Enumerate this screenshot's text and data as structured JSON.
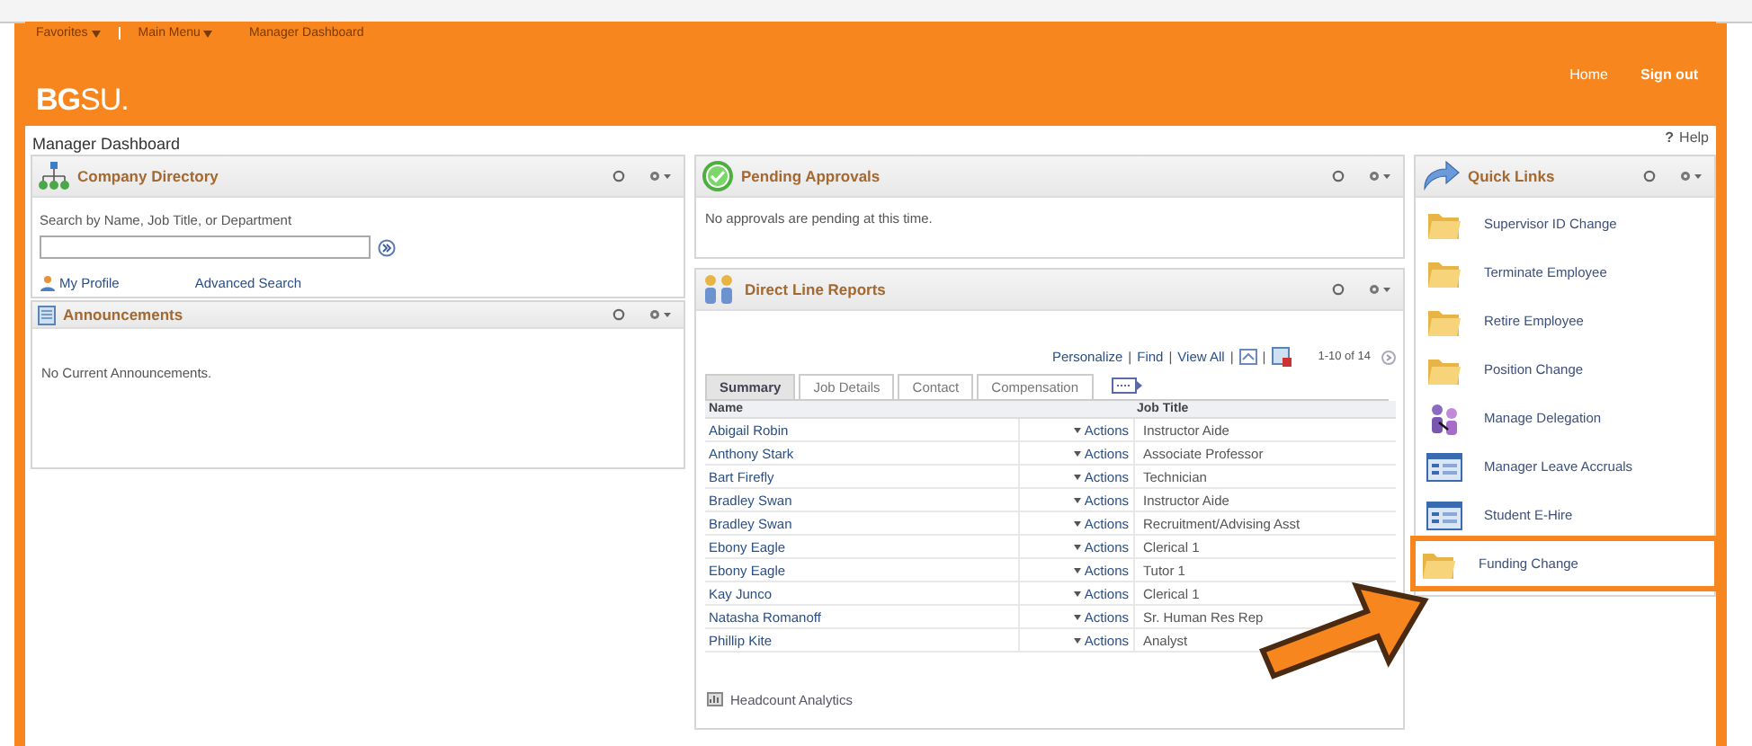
{
  "header": {
    "breadcrumbs": [
      {
        "label": "Favorites",
        "dropdown": true
      },
      {
        "label": "Main Menu",
        "dropdown": true
      },
      {
        "label": "Manager Dashboard",
        "dropdown": false
      }
    ],
    "logo": {
      "bold": "BG",
      "light": "SU."
    },
    "links": [
      "Home",
      "Sign out"
    ]
  },
  "page": {
    "title": "Manager Dashboard",
    "help": {
      "mark": "?",
      "label": "Help"
    }
  },
  "company_directory": {
    "title": "Company Directory",
    "search_label": "Search by Name, Job Title, or Department",
    "links": [
      "My Profile",
      "Advanced Search"
    ]
  },
  "announcements": {
    "title": "Announcements",
    "message": "No Current Announcements."
  },
  "pending_approvals": {
    "title": "Pending Approvals",
    "message": "No approvals are pending at this time."
  },
  "direct_line_reports": {
    "title": "Direct Line Reports",
    "toolbar": {
      "links": [
        "Personalize",
        "Find",
        "View All"
      ],
      "separator": "|",
      "count": "1-10 of 14"
    },
    "tabs": [
      {
        "label": "Summary",
        "selected": true
      },
      {
        "label": "Job Details",
        "selected": false
      },
      {
        "label": "Contact",
        "selected": false
      },
      {
        "label": "Compensation",
        "selected": false
      }
    ],
    "columns": [
      "Name",
      "Job Title"
    ],
    "rows": [
      {
        "name": "Abigail Robin",
        "action": "Actions",
        "job_title": "Instructor Aide"
      },
      {
        "name": "Anthony Stark",
        "action": "Actions",
        "job_title": "Associate Professor"
      },
      {
        "name": "Bart Firefly",
        "action": "Actions",
        "job_title": "Technician"
      },
      {
        "name": "Bradley Swan",
        "action": "Actions",
        "job_title": "Instructor Aide"
      },
      {
        "name": "Bradley Swan",
        "action": "Actions",
        "job_title": "Recruitment/Advising Asst"
      },
      {
        "name": "Ebony Eagle",
        "action": "Actions",
        "job_title": "Clerical 1"
      },
      {
        "name": "Ebony Eagle",
        "action": "Actions",
        "job_title": "Tutor 1"
      },
      {
        "name": "Kay Junco",
        "action": "Actions",
        "job_title": "Clerical 1"
      },
      {
        "name": "Natasha Romanoff",
        "action": "Actions",
        "job_title": "Sr. Human Res Rep"
      },
      {
        "name": "Phillip Kite",
        "action": "Actions",
        "job_title": "Analyst"
      }
    ],
    "footer_link": "Headcount Analytics"
  },
  "quick_links": {
    "title": "Quick Links",
    "items": [
      {
        "label": "Supervisor ID Change",
        "kind": "folder",
        "highlighted": false
      },
      {
        "label": "Terminate Employee",
        "kind": "folder",
        "highlighted": false
      },
      {
        "label": "Retire Employee",
        "kind": "folder",
        "highlighted": false
      },
      {
        "label": "Position Change",
        "kind": "folder",
        "highlighted": false
      },
      {
        "label": "Manage Delegation",
        "kind": "people",
        "highlighted": false
      },
      {
        "label": "Manager Leave Accruals",
        "kind": "form",
        "highlighted": false
      },
      {
        "label": "Student E-Hire",
        "kind": "form",
        "highlighted": false
      },
      {
        "label": "Funding Change",
        "kind": "folder",
        "highlighted": true
      }
    ]
  }
}
